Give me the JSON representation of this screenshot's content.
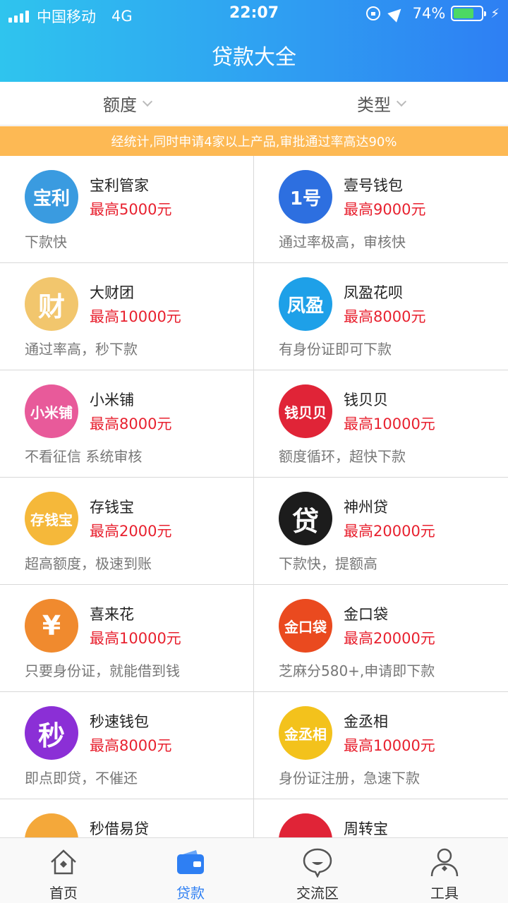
{
  "status_bar": {
    "carrier": "中国移动",
    "network": "4G",
    "time": "22:07",
    "battery": "74%",
    "battery_level": 0.74
  },
  "header": {
    "title": "贷款大全"
  },
  "filters": [
    {
      "label": "额度"
    },
    {
      "label": "类型"
    }
  ],
  "notice": "经统计,同时申请4家以上产品,审批通过率高达90%",
  "products": [
    {
      "name": "宝利管家",
      "amount": "最高5000元",
      "desc": "下款快",
      "logo_text": "宝利",
      "logo_color": "#3a9be0"
    },
    {
      "name": "壹号钱包",
      "amount": "最高9000元",
      "desc": "通过率极高，审核快",
      "logo_text": "1号",
      "logo_color": "#2d6fe0"
    },
    {
      "name": "大财团",
      "amount": "最高10000元",
      "desc": "通过率高，秒下款",
      "logo_text": "财",
      "logo_color": "#f2c66d"
    },
    {
      "name": "凤盈花呗",
      "amount": "最高8000元",
      "desc": "有身份证即可下款",
      "logo_text": "凤盈",
      "logo_color": "#1ea0e8"
    },
    {
      "name": "小米铺",
      "amount": "最高8000元",
      "desc": "不看征信 系统审核",
      "logo_text": "小米铺",
      "logo_color": "#e85a9a"
    },
    {
      "name": "钱贝贝",
      "amount": "最高10000元",
      "desc": "额度循环，超快下款",
      "logo_text": "钱贝贝",
      "logo_color": "#e02437"
    },
    {
      "name": "存钱宝",
      "amount": "最高2000元",
      "desc": "超高额度，极速到账",
      "logo_text": "存钱宝",
      "logo_color": "#f5b83a"
    },
    {
      "name": "神州贷",
      "amount": "最高20000元",
      "desc": "下款快，提额高",
      "logo_text": "贷",
      "logo_color": "#1c1c1c"
    },
    {
      "name": "喜来花",
      "amount": "最高10000元",
      "desc": "只要身份证，就能借到钱",
      "logo_text": "¥",
      "logo_color": "#f08a2e"
    },
    {
      "name": "金口袋",
      "amount": "最高20000元",
      "desc": "芝麻分580+,申请即下款",
      "logo_text": "金口袋",
      "logo_color": "#ea4a1f"
    },
    {
      "name": "秒速钱包",
      "amount": "最高8000元",
      "desc": "即点即贷，不催还",
      "logo_text": "秒",
      "logo_color": "#8b2fd6"
    },
    {
      "name": "金丞相",
      "amount": "最高10000元",
      "desc": "身份证注册，急速下款",
      "logo_text": "金丞相",
      "logo_color": "#f3c21c"
    },
    {
      "name": "秒借易贷",
      "amount": "",
      "desc": "",
      "logo_text": "",
      "logo_color": "#f4a83a"
    },
    {
      "name": "周转宝",
      "amount": "",
      "desc": "",
      "logo_text": "",
      "logo_color": "#e02437"
    }
  ],
  "tabs": [
    {
      "label": "首页",
      "icon": "home-icon"
    },
    {
      "label": "贷款",
      "icon": "wallet-icon",
      "active": true
    },
    {
      "label": "交流区",
      "icon": "chat-icon"
    },
    {
      "label": "工具",
      "icon": "user-icon"
    }
  ],
  "colors": {
    "accent": "#2e7ff3",
    "amount": "#e8212f",
    "notice_bg": "#fdb954"
  }
}
